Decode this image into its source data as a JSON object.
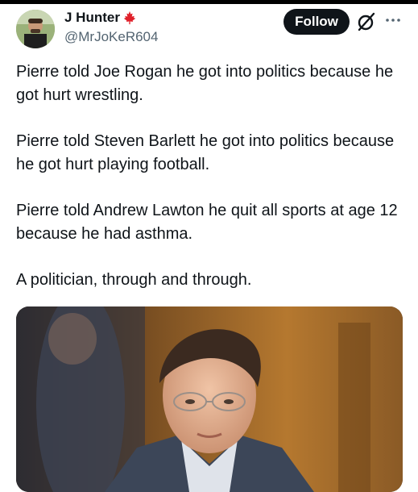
{
  "author": {
    "display_name": "J Hunter",
    "flag_icon": "maple-leaf-icon",
    "handle": "@MrJoKeR604"
  },
  "actions": {
    "follow_label": "Follow",
    "grok_icon": "grok-icon",
    "more_icon": "more-options-icon"
  },
  "tweet": {
    "paragraphs": [
      "Pierre told Joe Rogan he got into politics because he got hurt wrestling.",
      "Pierre told Steven Barlett he got into politics because he got hurt playing football.",
      "Pierre told Andrew Lawton he quit all sports at age 12 because he had asthma.",
      "A politician, through and through."
    ]
  },
  "colors": {
    "text": "#0f1419",
    "secondary": "#536471",
    "button_bg": "#0f1419",
    "flag_red": "#e0202a"
  }
}
